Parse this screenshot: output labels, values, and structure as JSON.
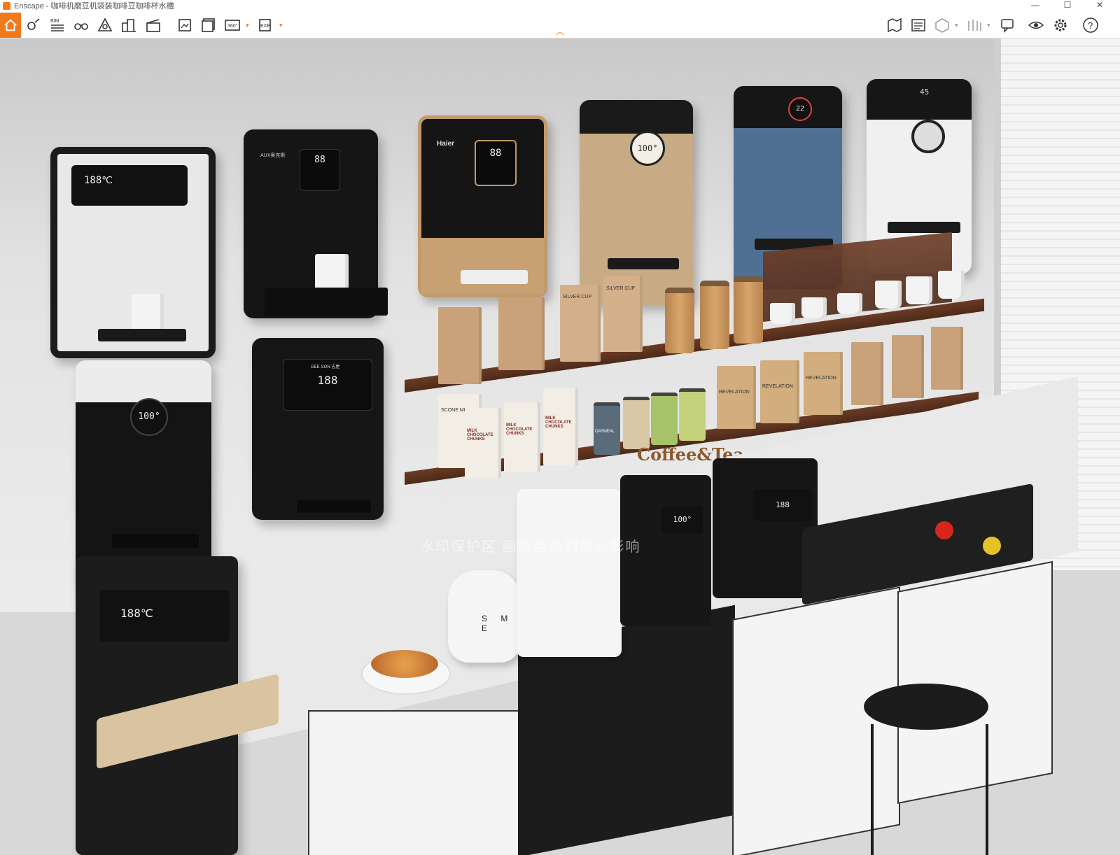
{
  "window": {
    "title": "Enscape - 咖啡机磨豆机袋装咖啡豆咖啡杯水槽",
    "controls": {
      "minimize": "—",
      "maximize": "☐",
      "close": "✕"
    }
  },
  "toolbar": {
    "bim_label": "BIM",
    "accent_color": "#f07b1d"
  },
  "scene": {
    "sign_text": "Coffee&Tea",
    "watermark_text": "水印保护区  画质会受到部分影响",
    "brands": {
      "aux": "AUX奥克斯",
      "haier": "Haier",
      "geeson": "GEE·SON 吉屋"
    },
    "displays": {
      "d1": "188℃",
      "d2": "88",
      "d3": "88",
      "d4": "100°",
      "d5": "22",
      "d6": "45",
      "d7": "100°",
      "d8": "188",
      "counter_display": "188℃",
      "machine1": "100°",
      "machine2": "188"
    },
    "labels": {
      "silver_cup": "SILVER CUP",
      "revelation": "REVELATION",
      "scone_mix": "SCONE MIX",
      "milk_choc": "MILK CHOCOLATE CHUNKS",
      "oatmeal": "OATMEAL",
      "kettle": "S M E"
    }
  }
}
